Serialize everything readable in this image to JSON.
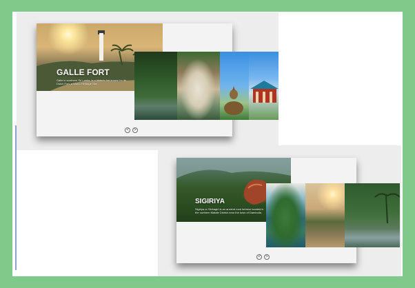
{
  "slides": [
    {
      "title": "GALLE FORT",
      "description": "Galle in southern Sri Lanka, is a historic fort known for its Dutch Fort, a World Heritage Site.",
      "nav": {
        "prev": "<",
        "next": ">"
      },
      "thumbnails": [
        "forest-lake",
        "rock-beach-aerial",
        "buddha-statue",
        "temple-roof"
      ]
    },
    {
      "title": "SIGIRIYA",
      "description": "Sigiriya or Sinhagiri is an ancient rock fortress located in the northern Matale District near the town of Dambulla.",
      "nav": {
        "prev": "<",
        "next": ">"
      },
      "thumbnails": [
        "coast-aerial",
        "sunset-coast",
        "palm-lake"
      ]
    }
  ]
}
